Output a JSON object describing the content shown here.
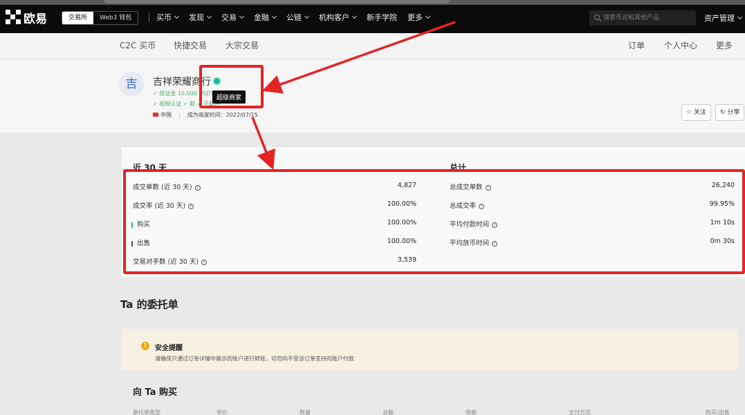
{
  "topbar": {
    "brand": "欧易",
    "seg": [
      "交易所",
      "Web3 钱包"
    ],
    "nav": [
      "买币",
      "发现",
      "交易",
      "金融",
      "公链",
      "机构客户",
      "新手学院",
      "更多"
    ],
    "search_placeholder": "搜索币对和其他产品",
    "asset": "资产管理"
  },
  "subnav": {
    "left": [
      "C2C 买币",
      "快捷交易",
      "大宗交易"
    ],
    "right": [
      "订单",
      "个人中心",
      "更多"
    ]
  },
  "merchant": {
    "avatar": "吉",
    "name": "吉祥荣耀商行",
    "line1": "✓ 保证金 10,000 USDT",
    "line2": "✓ 视频认证   ✓ 邮   ✓ 子邮件",
    "tooltip": "超级商家",
    "region": "中国",
    "since": "成为商家时间：2022/07/15",
    "follow": "☆ 关注",
    "share": "分享"
  },
  "stats": {
    "left_title": "近 30 天",
    "right_title": "总计",
    "left": [
      {
        "label": "成交单数 (近 30 天)",
        "value": "4,827",
        "info": true
      },
      {
        "label": "成交率 (近 30 天)",
        "value": "100.00%",
        "info": true
      },
      {
        "label": "购买",
        "value": "100.00%",
        "bar": "green"
      },
      {
        "label": "出售",
        "value": "100.00%",
        "bar": "gray"
      },
      {
        "label": "交易对手数 (近 30 天)",
        "value": "3,539",
        "info": true
      }
    ],
    "right": [
      {
        "label": "总成交单数",
        "value": "26,240",
        "info": true
      },
      {
        "label": "总成交率",
        "value": "99.95%",
        "info": true
      },
      {
        "label": "平均付款时间",
        "value": "1m 10s",
        "info": true
      },
      {
        "label": "平均放币时间",
        "value": "0m 30s",
        "info": true
      }
    ]
  },
  "orders": {
    "title": "Ta 的委托单",
    "notice_title": "安全提醒",
    "notice_text": "请确保只通过订单详情中展示的账户进行转账，切勿向不受该订单支持的账户付款",
    "buy_title": "向 Ta 购买",
    "columns": [
      "委托单类型",
      "单价",
      "数量",
      "总额",
      "限额",
      "支付方式",
      "购买/出售"
    ]
  },
  "colors": {
    "accent_red": "#e62323",
    "verified_green": "#22b59a"
  }
}
